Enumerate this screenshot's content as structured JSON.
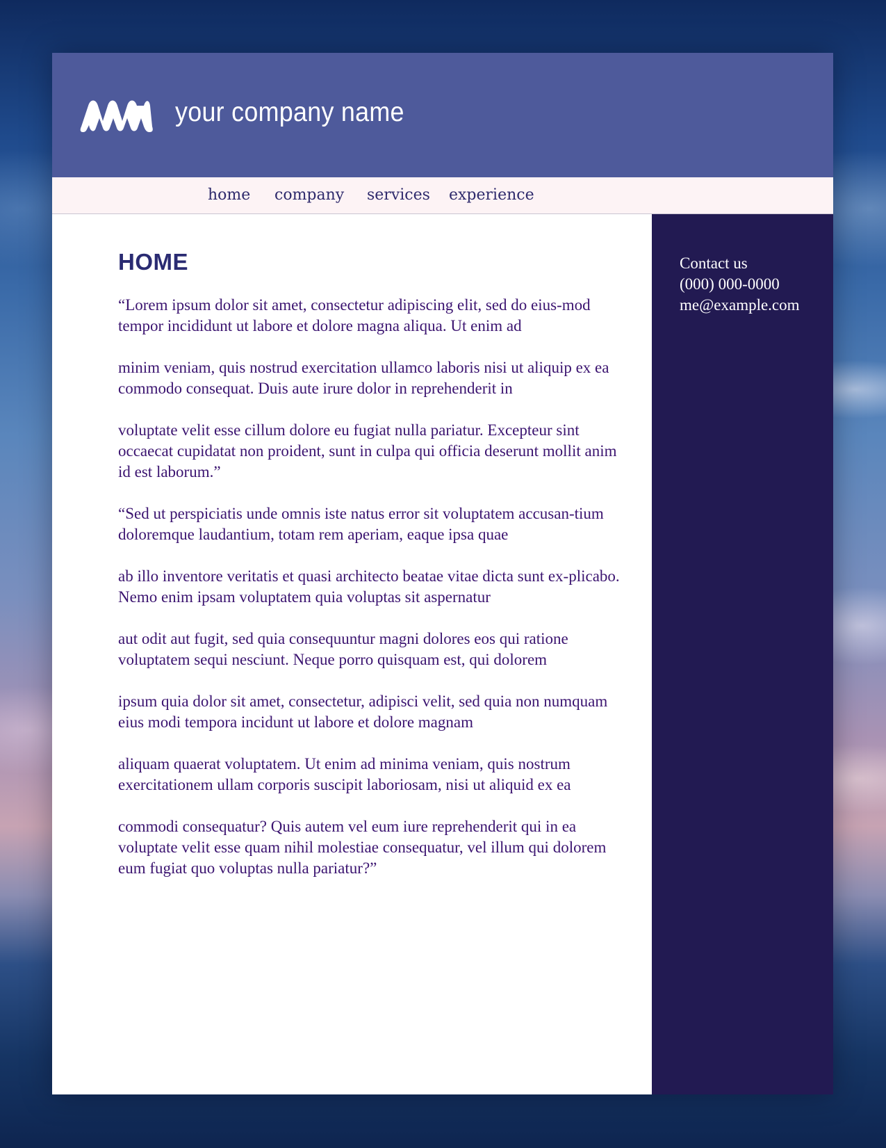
{
  "header": {
    "logo_icon": "mountain-logo-icon",
    "company_name": "your company name",
    "background_color": "#4e5a9b"
  },
  "nav": {
    "items": [
      {
        "label": "home"
      },
      {
        "label": "company"
      },
      {
        "label": "services"
      },
      {
        "label": "experience"
      }
    ]
  },
  "main": {
    "title": "HOME",
    "paragraphs": [
      "“Lorem ipsum dolor sit amet, consectetur adipiscing elit, sed do eius-mod tempor incididunt ut labore et dolore magna aliqua. Ut enim ad",
      "minim veniam, quis nostrud exercitation ullamco laboris nisi ut aliquip ex ea commodo consequat. Duis aute irure dolor in reprehenderit in",
      "voluptate velit esse cillum dolore eu fugiat nulla pariatur. Excepteur sint occaecat cupidatat non proident, sunt in culpa qui officia deserunt mollit anim id est laborum.”",
      "“Sed ut perspiciatis unde omnis iste natus error sit voluptatem accusan-tium doloremque laudantium, totam rem aperiam, eaque ipsa quae",
      "ab illo inventore veritatis et quasi architecto beatae vitae dicta sunt ex-plicabo. Nemo enim ipsam voluptatem quia voluptas sit aspernatur",
      "aut odit aut fugit, sed quia consequuntur magni dolores eos qui ratione voluptatem sequi nesciunt. Neque porro quisquam est, qui dolorem",
      "ipsum quia dolor sit amet, consectetur, adipisci velit, sed quia non numquam eius modi tempora incidunt ut labore et dolore magnam",
      "aliquam quaerat voluptatem. Ut enim ad minima veniam, quis nostrum exercitationem ullam corporis suscipit laboriosam, nisi ut aliquid ex ea",
      "commodi consequatur? Quis autem vel eum iure reprehenderit qui in ea voluptate velit esse quam nihil molestiae consequatur, vel illum qui dolorem eum fugiat quo voluptas nulla pariatur?”"
    ]
  },
  "sidebar": {
    "contact_label": "Contact us",
    "phone": "(000) 000-0000",
    "email": "me@example.com",
    "background_color": "#221a52"
  }
}
